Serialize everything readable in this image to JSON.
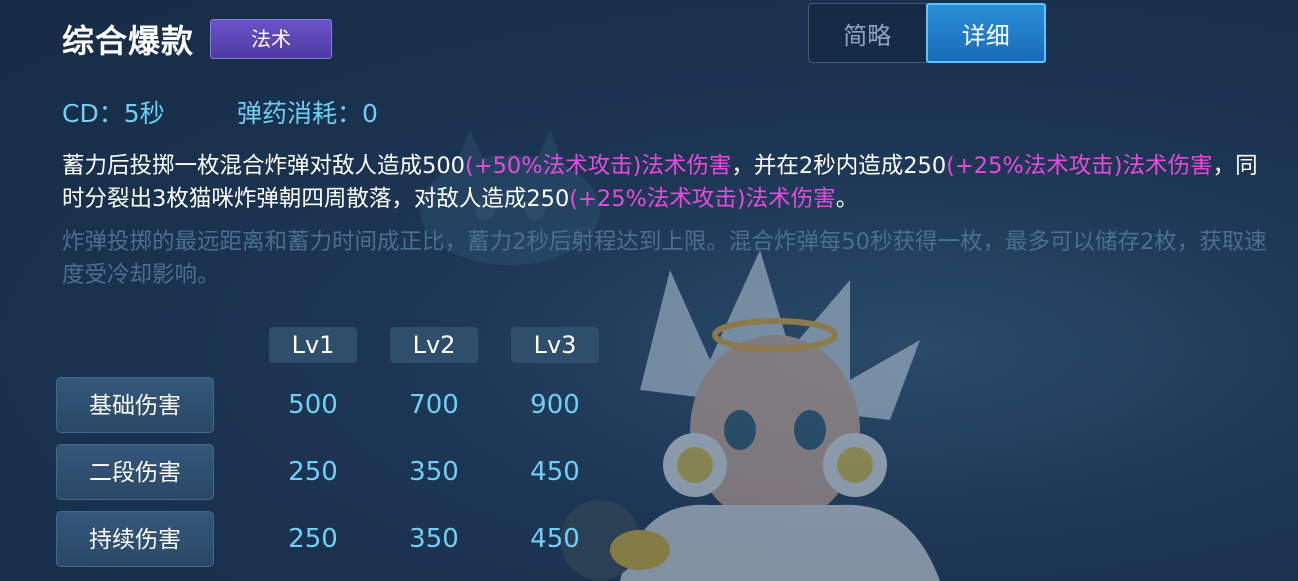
{
  "header": {
    "title": "综合爆款",
    "tag": "法术"
  },
  "toggle": {
    "brief": "简略",
    "detail": "详细",
    "selected": "详细"
  },
  "stats": {
    "cd": "CD：5秒",
    "ammo": "弹药消耗：0"
  },
  "description": {
    "p1": "蓄力后投掷一枚混合炸弹对敌人造成500",
    "h1": "(+50%法术攻击)法术伤害",
    "p2": "，并在2秒内造成250",
    "h2": "(+25%法术攻击)法术伤害",
    "p3": "，同时分裂出3枚猫咪炸弹朝四周散落，对敌人造成250",
    "h3": "(+25%法术攻击)法术伤害",
    "p4": "。",
    "extra": "炸弹投掷的最远距离和蓄力时间成正比，蓄力2秒后射程达到上限。混合炸弹每50秒获得一枚，最多可以储存2枚，获取速度受冷却影响。"
  },
  "table": {
    "levels": [
      "Lv1",
      "Lv2",
      "Lv3"
    ],
    "rows": [
      {
        "label": "基础伤害",
        "values": [
          "500",
          "700",
          "900"
        ]
      },
      {
        "label": "二段伤害",
        "values": [
          "250",
          "350",
          "450"
        ]
      },
      {
        "label": "持续伤害",
        "values": [
          "250",
          "350",
          "450"
        ]
      }
    ]
  },
  "colors": {
    "accent_cyan": "#6fcff5",
    "highlight_magenta": "#e64bdd",
    "tag_purple": "#5a46b8",
    "toggle_active": "#1f7cc6"
  }
}
